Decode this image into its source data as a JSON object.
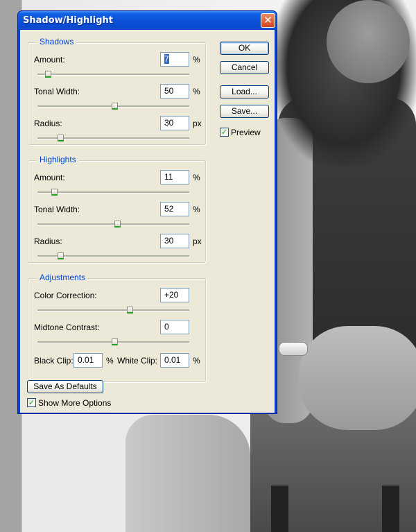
{
  "window": {
    "title": "Shadow/Highlight",
    "close_glyph": "✕"
  },
  "shadows": {
    "title": "Shadows",
    "amount": {
      "label": "Amount:",
      "value": "7",
      "unit": "%",
      "slider": 0.07
    },
    "tonal_width": {
      "label": "Tonal Width:",
      "value": "50",
      "unit": "%",
      "slider": 0.5
    },
    "radius": {
      "label": "Radius:",
      "value": "30",
      "unit": "px",
      "slider": 0.12
    }
  },
  "highlights": {
    "title": "Highlights",
    "amount": {
      "label": "Amount:",
      "value": "11",
      "unit": "%",
      "slider": 0.11
    },
    "tonal_width": {
      "label": "Tonal Width:",
      "value": "52",
      "unit": "%",
      "slider": 0.52
    },
    "radius": {
      "label": "Radius:",
      "value": "30",
      "unit": "px",
      "slider": 0.12
    }
  },
  "adjustments": {
    "title": "Adjustments",
    "color_correction": {
      "label": "Color Correction:",
      "value": "+20",
      "slider": 0.6
    },
    "midtone_contrast": {
      "label": "Midtone Contrast:",
      "value": "0",
      "slider": 0.5
    },
    "black_clip": {
      "label": "Black Clip:",
      "value": "0.01",
      "unit": "%"
    },
    "white_clip": {
      "label": "White Clip:",
      "value": "0.01",
      "unit": "%"
    }
  },
  "buttons": {
    "ok": "OK",
    "cancel": "Cancel",
    "load": "Load...",
    "save": "Save...",
    "save_defaults": "Save As Defaults"
  },
  "preview": {
    "label": "Preview",
    "checked": true
  },
  "show_more": {
    "label": "Show More Options",
    "checked": true
  },
  "check_glyph": "✓",
  "colors": {
    "title_bar": "#0a4fd6",
    "group_title": "#0046d5",
    "dialog_bg": "#ece9d8",
    "slider_thumb_accent": "#21a121"
  }
}
